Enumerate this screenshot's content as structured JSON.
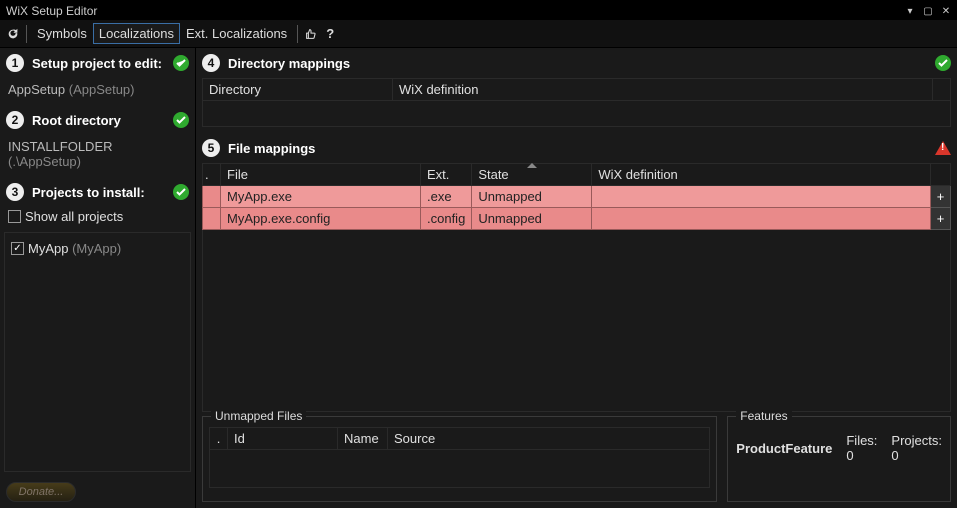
{
  "window": {
    "title": "WiX Setup Editor"
  },
  "toolbar": {
    "refresh_icon": "refresh",
    "tabs": [
      "Symbols",
      "Localizations",
      "Ext. Localizations"
    ],
    "active_tab": 1,
    "thumbs_icon": "thumbs-up",
    "help_icon": "?"
  },
  "left": {
    "step1": {
      "num": "1",
      "title": "Setup project to edit:"
    },
    "setup_project": {
      "name": "AppSetup",
      "detail": "(AppSetup)"
    },
    "step2": {
      "num": "2",
      "title": "Root directory"
    },
    "root_dir": {
      "name": "INSTALLFOLDER",
      "detail": "(.\\AppSetup)"
    },
    "step3": {
      "num": "3",
      "title": "Projects to install:"
    },
    "show_all_label": "Show all projects",
    "show_all_checked": false,
    "projects": [
      {
        "name": "MyApp",
        "detail": "(MyApp)",
        "checked": true
      }
    ],
    "donate_label": "Donate..."
  },
  "right": {
    "step4": {
      "num": "4",
      "title": "Directory mappings"
    },
    "dir_cols": {
      "directory": "Directory",
      "wix": "WiX definition"
    },
    "step5": {
      "num": "5",
      "title": "File mappings"
    },
    "file_cols": {
      "file": "File",
      "ext": "Ext.",
      "state": "State",
      "wix": "WiX definition"
    },
    "files": [
      {
        "file": "MyApp.exe",
        "ext": ".exe",
        "state": "Unmapped",
        "wix": ""
      },
      {
        "file": "MyApp.exe.config",
        "ext": ".config",
        "state": "Unmapped",
        "wix": ""
      }
    ],
    "unmapped": {
      "legend": "Unmapped Files",
      "cols": {
        "id": "Id",
        "name": "Name",
        "source": "Source"
      }
    },
    "features": {
      "legend": "Features",
      "name": "ProductFeature",
      "files_label": "Files:",
      "files_count": "0",
      "projects_label": "Projects:",
      "projects_count": "0"
    }
  }
}
